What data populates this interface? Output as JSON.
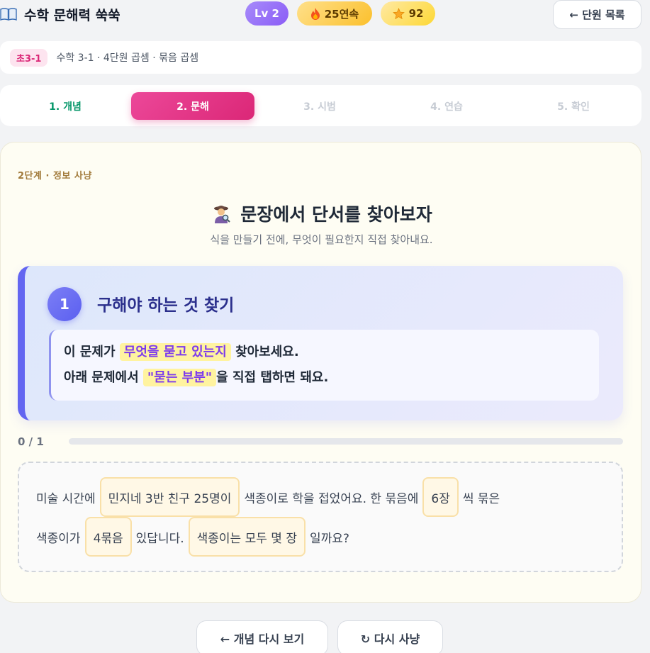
{
  "header": {
    "app_title": "수학 문해력 쑥쑥",
    "level": "Lv 2",
    "streak": "25연속",
    "stars": "92",
    "back_label": "← 단원 목록"
  },
  "breadcrumb": {
    "badge": "초3-1",
    "text": "수학 3-1 · 4단원 곱셈 · 묶음 곱셈"
  },
  "steps": [
    {
      "label": "1. 개념",
      "state": "done"
    },
    {
      "label": "2. 문해",
      "state": "active"
    },
    {
      "label": "3. 시범",
      "state": "todo"
    },
    {
      "label": "4. 연습",
      "state": "todo"
    },
    {
      "label": "5. 확인",
      "state": "todo"
    }
  ],
  "main": {
    "stage_label": "2단계 · 정보 사냥",
    "heading": "문장에서 단서를 찾아보자",
    "subheading": "식을 만들기 전에, 무엇이 필요한지 직접 찾아내요.",
    "task": {
      "number": "1",
      "title": "구해야 하는 것 찾기",
      "line1_pre": "이 문제가 ",
      "line1_hl": "무엇을 묻고 있는지",
      "line1_post": " 찾아보세요.",
      "line2_pre": "아래 문제에서 ",
      "line2_hl": "\"묻는 부분\"",
      "line2_post": "을 직접 탭하면 돼요."
    },
    "progress": {
      "label": "0 / 1",
      "value": 0
    },
    "problem": {
      "l1_t1": "미술 시간에",
      "l1_c1": "민지네 3반 친구 25명이",
      "l1_t2": "색종이로 학을 접었어요. 한 묶음에",
      "l1_c2": "6장",
      "l1_t3": "씩 묶은",
      "l2_t1": "색종이가",
      "l2_c1": "4묶음",
      "l2_t2": "있답니다.",
      "l2_c2": "색종이는 모두 몇 장",
      "l2_t3": "일까요?"
    }
  },
  "buttons": {
    "review": "← 개념 다시 보기",
    "retry": "↻ 다시 사냥"
  },
  "icons": {
    "app": "book-icon",
    "streak": "fire-icon",
    "stars": "star-icon",
    "heading": "detective-icon"
  },
  "colors": {
    "accent_pink": "#db2777",
    "accent_indigo": "#6366f1",
    "done_green": "#059669",
    "highlight": "#fff3a0"
  }
}
